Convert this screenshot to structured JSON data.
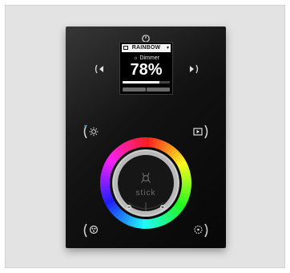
{
  "device": {
    "screen": {
      "scene_name": "RAINBOW",
      "dropdown_glyph": "▾",
      "mode_label": "☼ Dimmer",
      "value": "78%",
      "level": 0.78
    },
    "brand": "stick",
    "icons": {
      "power": "power-icon",
      "left": "arrow-left-icon",
      "right": "arrow-right-icon",
      "top_left": "brightness-icon",
      "top_right": "scene-play-icon",
      "bottom_left": "color-palette-icon",
      "bottom_right": "effect-icon",
      "wheel_minus": "minus-icon",
      "wheel_plus": "plus-icon"
    },
    "colors": {
      "panel": "#0b0b0b",
      "ring": "#c0c0c0",
      "accent_dot": "#2f8fd8"
    }
  }
}
